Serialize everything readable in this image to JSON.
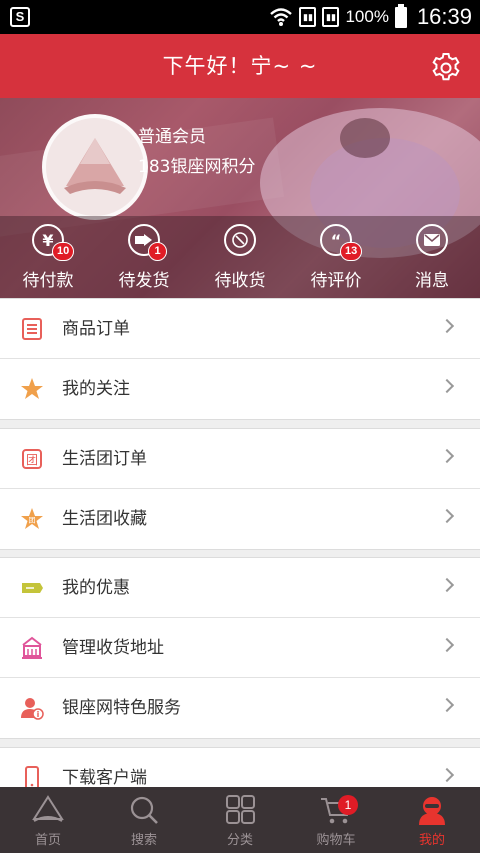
{
  "status_bar": {
    "battery": "100%",
    "time": "16:39",
    "carrier_icon": "S"
  },
  "header": {
    "title": "下午好！宁~ ~",
    "settings_icon": "gear-icon"
  },
  "profile": {
    "level": "普通会员",
    "points": "183银座网积分"
  },
  "orders": [
    {
      "label": "待付款",
      "icon": "yen-icon",
      "badge": "10"
    },
    {
      "label": "待发货",
      "icon": "send-icon",
      "badge": "1"
    },
    {
      "label": "待收货",
      "icon": "receive-icon",
      "badge": ""
    },
    {
      "label": "待评价",
      "icon": "quote-icon",
      "badge": "13"
    },
    {
      "label": "消息",
      "icon": "mail-icon",
      "badge": ""
    }
  ],
  "menu": {
    "group1": [
      {
        "label": "商品订单",
        "icon": "order-list-icon",
        "color": "#e8605a"
      },
      {
        "label": "我的关注",
        "icon": "star-icon",
        "color": "#f0a04b"
      }
    ],
    "group2": [
      {
        "label": "生活团订单",
        "icon": "group-order-icon",
        "color": "#e8605a"
      },
      {
        "label": "生活团收藏",
        "icon": "group-star-icon",
        "color": "#f0a04b"
      }
    ],
    "group3": [
      {
        "label": "我的优惠",
        "icon": "coupon-icon",
        "color": "#c4c43a"
      },
      {
        "label": "管理收货地址",
        "icon": "address-icon",
        "color": "#e0559a"
      },
      {
        "label": "银座网特色服务",
        "icon": "service-icon",
        "color": "#e8605a"
      }
    ],
    "group4": [
      {
        "label": "下载客户端",
        "icon": "phone-icon",
        "color": "#e8605a"
      }
    ]
  },
  "tabbar": [
    {
      "label": "首页",
      "icon": "home-icon",
      "active": false
    },
    {
      "label": "搜索",
      "icon": "search-icon",
      "active": false
    },
    {
      "label": "分类",
      "icon": "category-icon",
      "active": false
    },
    {
      "label": "购物车",
      "icon": "cart-icon",
      "active": false,
      "badge": "1"
    },
    {
      "label": "我的",
      "icon": "user-icon",
      "active": true
    }
  ],
  "colors": {
    "primary": "#d6323d",
    "tab_active": "#e8342e",
    "tabbar_bg": "#3a3335"
  }
}
